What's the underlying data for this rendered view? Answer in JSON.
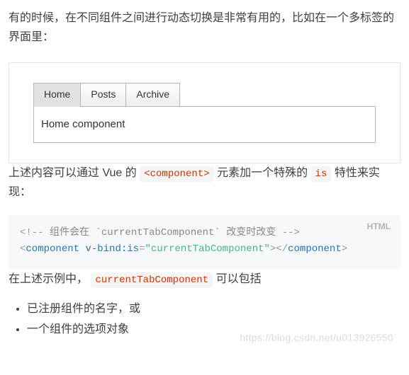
{
  "para1": "有的时候，在不同组件之间进行动态切换是非常有用的，比如在一个多标签的界面里：",
  "example": {
    "tabs": [
      "Home",
      "Posts",
      "Archive"
    ],
    "active_index": 0,
    "panel_text": "Home component"
  },
  "para2": {
    "seg0": "上述内容可以通过 Vue 的 ",
    "code0": "<component>",
    "seg1": " 元素加一个特殊的 ",
    "code1": "is",
    "seg2": " 特性来实现："
  },
  "code": {
    "lang_label": "HTML",
    "comment_open": "<!--",
    "comment_body": " 组件会在 `currentTabComponent` 改变时改变 ",
    "comment_close": "-->",
    "tag_open_lt": "<",
    "tag_name": "component",
    "attr_name": "v-bind:is",
    "equals": "=",
    "attr_value_q": "\"currentTabComponent\"",
    "tag_open_gt": ">",
    "close_tag": "</",
    "tag_close_gt": ">"
  },
  "para3": {
    "seg0": "在上述示例中，",
    "code0": "currentTabComponent",
    "seg1": " 可以包括"
  },
  "bullets": [
    "已注册组件的名字，或",
    "一个组件的选项对象"
  ],
  "watermark": "https://blog.csdn.net/u013926550"
}
